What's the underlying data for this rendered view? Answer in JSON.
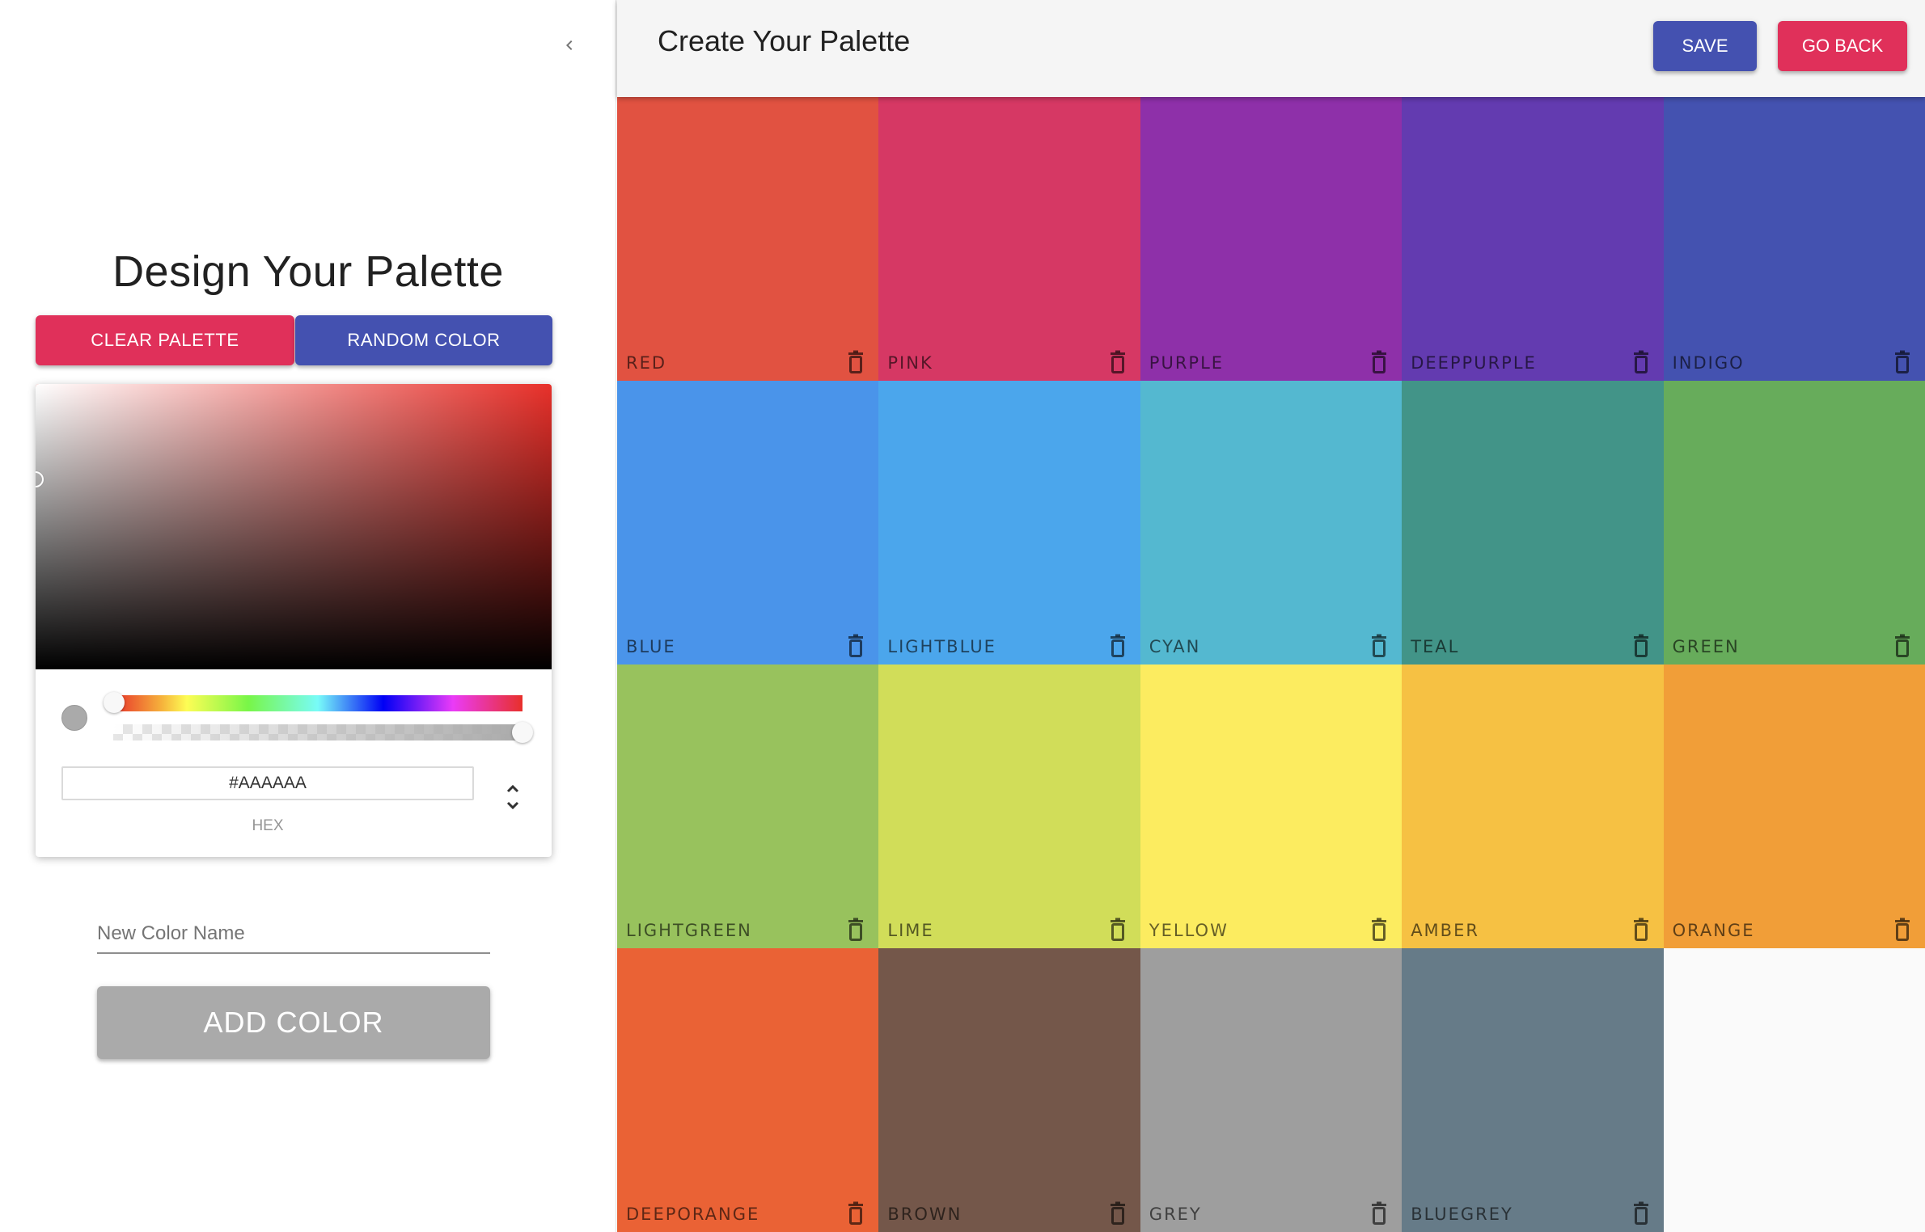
{
  "drawer": {
    "collapse_icon": "chevron-left-icon",
    "title": "Design Your Palette",
    "clear_button": "Clear Palette",
    "random_button": "Random Color",
    "picker": {
      "current_hex": "#AAAAAA",
      "format_label": "HEX",
      "hue_degrees": 0,
      "alpha": 1.0,
      "swatch_color": "#aaaaaa"
    },
    "color_name_placeholder": "New Color Name",
    "color_name_value": "",
    "add_button": "Add Color"
  },
  "appbar": {
    "title": "Create Your Palette",
    "save_button": "Save",
    "back_button": "Go Back"
  },
  "theme": {
    "primary": "#4451b0",
    "secondary": "#e0305a",
    "disabled": "#aaaaaa"
  },
  "palette": [
    {
      "name": "red",
      "color": "#e15241"
    },
    {
      "name": "pink",
      "color": "#d63864"
    },
    {
      "name": "purple",
      "color": "#8e30a9"
    },
    {
      "name": "deeppurple",
      "color": "#633bb0"
    },
    {
      "name": "indigo",
      "color": "#4452b0"
    },
    {
      "name": "blue",
      "color": "#4a94ea"
    },
    {
      "name": "lightblue",
      "color": "#4ba6ec"
    },
    {
      "name": "cyan",
      "color": "#54b8d0"
    },
    {
      "name": "teal",
      "color": "#429488"
    },
    {
      "name": "green",
      "color": "#67ac5b"
    },
    {
      "name": "lightgreen",
      "color": "#98c25d"
    },
    {
      "name": "lime",
      "color": "#d1dd59"
    },
    {
      "name": "yellow",
      "color": "#fcec60"
    },
    {
      "name": "amber",
      "color": "#f6c143"
    },
    {
      "name": "orange",
      "color": "#f19e38"
    },
    {
      "name": "deeporange",
      "color": "#ea6235"
    },
    {
      "name": "brown",
      "color": "#74574a"
    },
    {
      "name": "grey",
      "color": "#9e9e9e"
    },
    {
      "name": "bluegrey",
      "color": "#667b88"
    }
  ]
}
